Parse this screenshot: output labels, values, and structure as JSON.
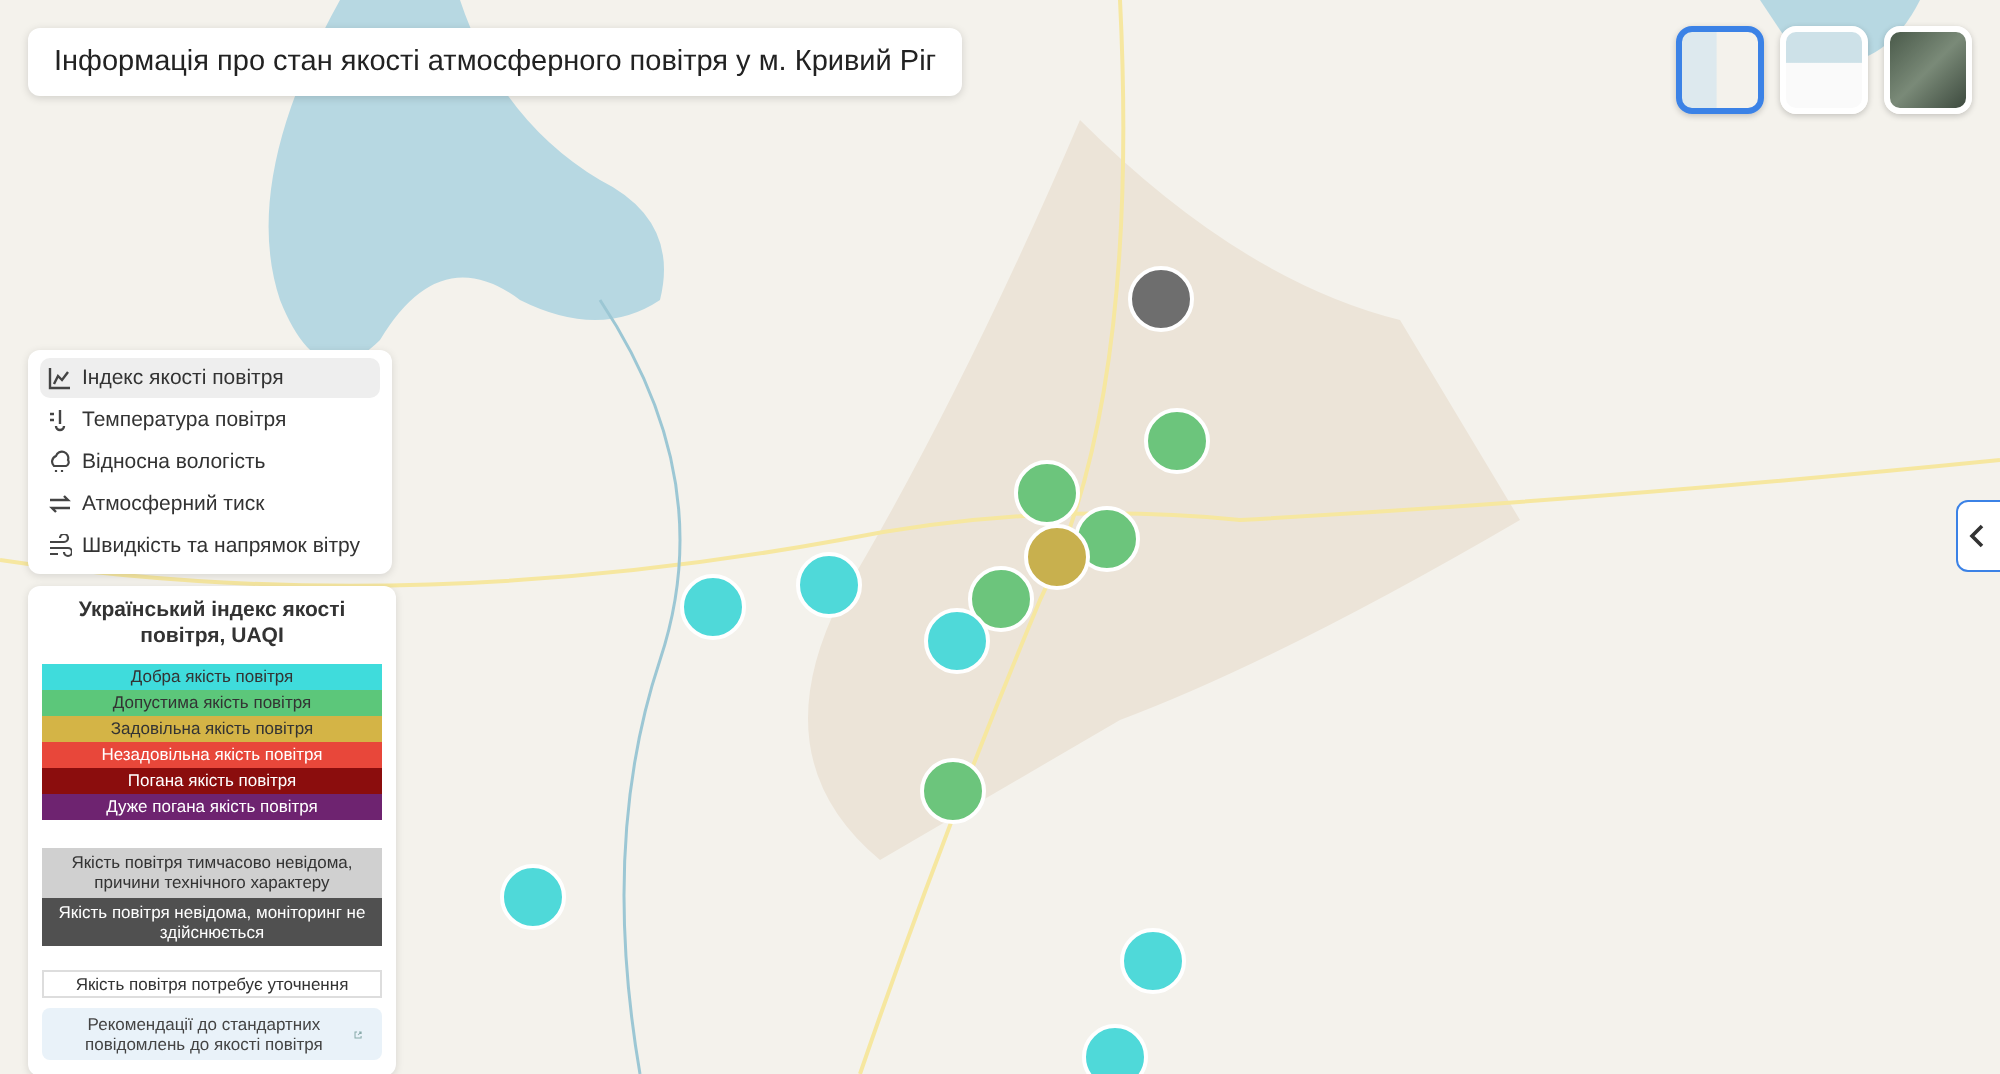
{
  "title": "Інформація про стан якості атмосферного повітря у м. Кривий Ріг",
  "map_styles": [
    {
      "kind": "light",
      "selected": true
    },
    {
      "kind": "plain",
      "selected": false
    },
    {
      "kind": "satellite",
      "selected": false
    }
  ],
  "layers": [
    {
      "kind": "index",
      "label": "Індекс якості повітря",
      "selected": true
    },
    {
      "kind": "temperature",
      "label": "Температура повітря",
      "selected": false
    },
    {
      "kind": "humidity",
      "label": "Відносна вологість",
      "selected": false
    },
    {
      "kind": "pressure",
      "label": "Атмосферний тиск",
      "selected": false
    },
    {
      "kind": "wind",
      "label": "Швидкість та напрямок вітру",
      "selected": false
    }
  ],
  "legend": {
    "title": "Український індекс якості повітря, UAQI",
    "levels": [
      {
        "label": "Добра якість повітря",
        "color": "#3fdcdc"
      },
      {
        "label": "Допустима якість повітря",
        "color": "#5cc77a"
      },
      {
        "label": "Задовільна якість повітря",
        "color": "#d4b446"
      },
      {
        "label": "Незадовільна якість повітря",
        "color": "#e8473a"
      },
      {
        "label": "Погана якість повітря",
        "color": "#8b0d0d"
      },
      {
        "label": "Дуже погана якість повітря",
        "color": "#6e2370"
      }
    ],
    "unknown": [
      {
        "label": "Якість повітря тимчасово невідома, причини технічного характеру",
        "color": "#d0d0d0"
      },
      {
        "label": "Якість повітря невідома, моніторинг не здійснюється",
        "color": "#505050"
      }
    ],
    "needs_clarification": "Якість повітря потребує уточнення",
    "recommendations_link": "Рекомендації до стандартних повідомлень до якості повітря"
  },
  "stations": [
    {
      "color": "#6e6e6e"
    },
    {
      "color": "#6cc57c"
    },
    {
      "color": "#6cc57c"
    },
    {
      "color": "#6cc57c"
    },
    {
      "color": "#c8b04e"
    },
    {
      "color": "#6cc57c"
    },
    {
      "color": "#4fd9d9"
    },
    {
      "color": "#4fd9d9"
    },
    {
      "color": "#4fd9d9"
    },
    {
      "color": "#6cc57c"
    },
    {
      "color": "#4fd9d9"
    },
    {
      "color": "#4fd9d9"
    },
    {
      "color": "#4fd9d9"
    }
  ]
}
